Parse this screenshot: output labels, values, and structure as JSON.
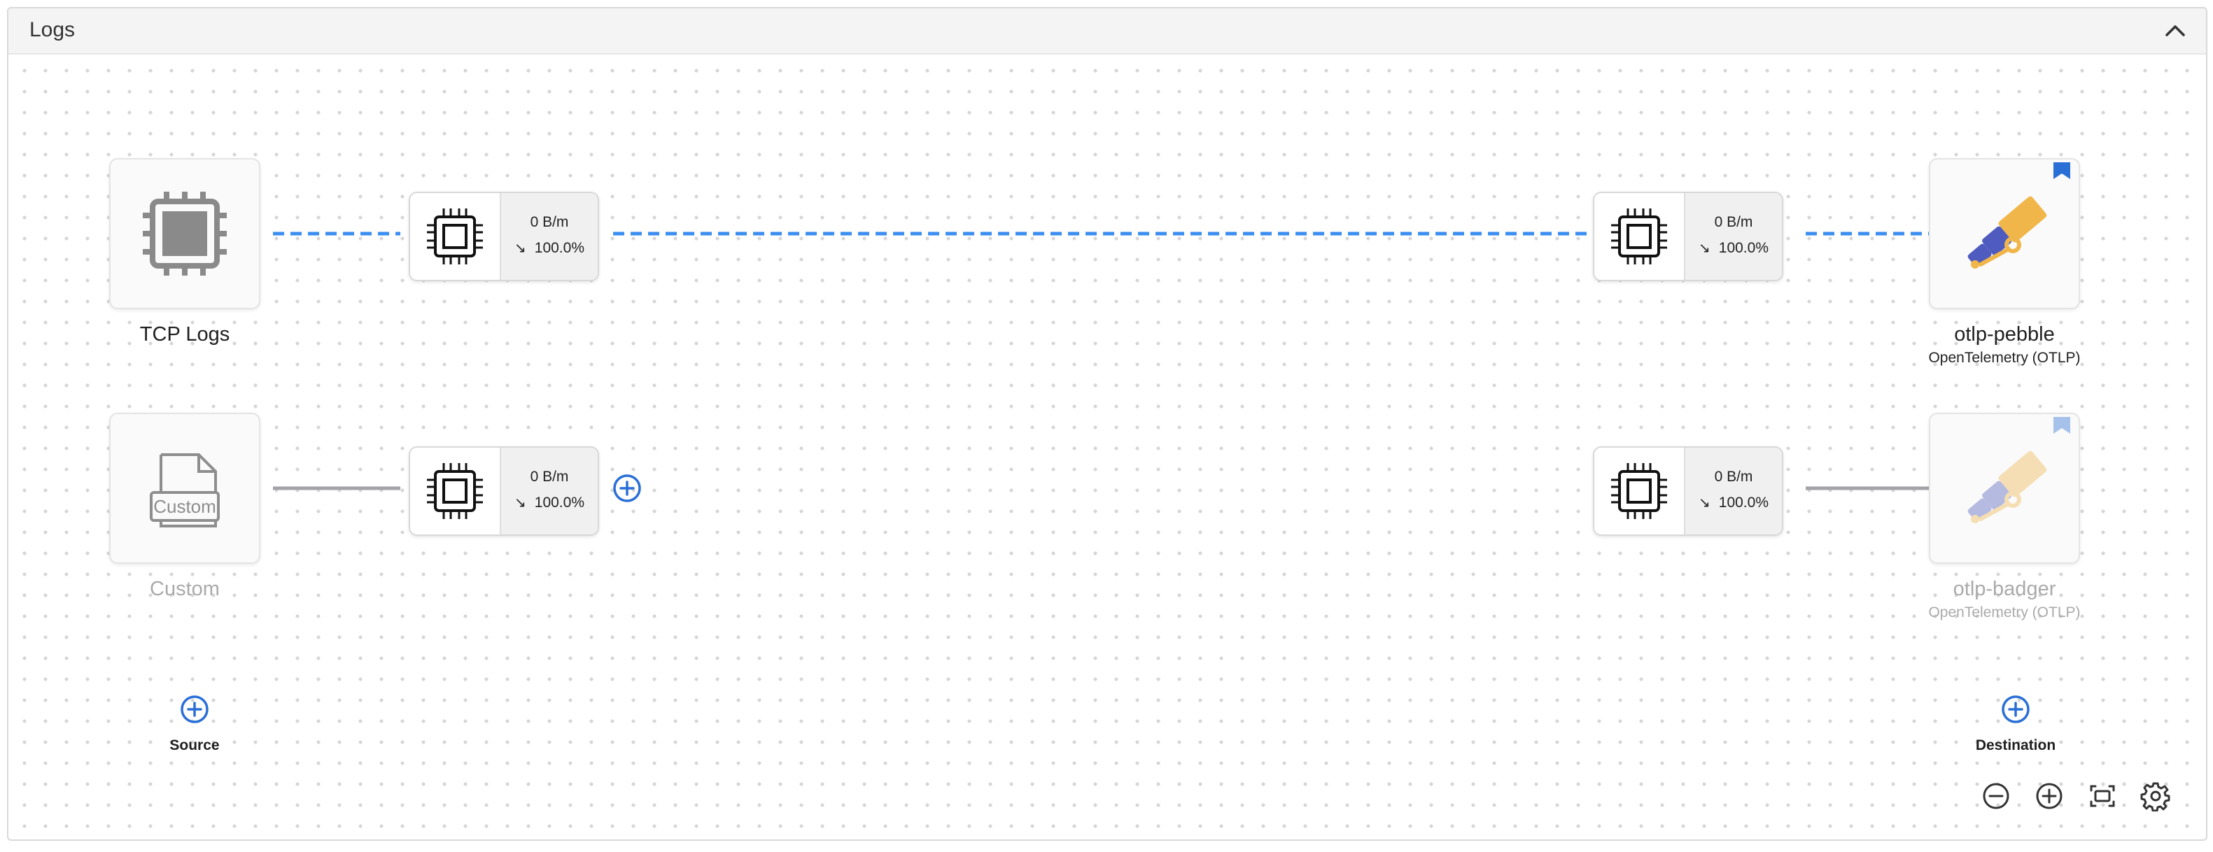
{
  "panel": {
    "title": "Logs"
  },
  "sources": [
    {
      "name": "TCP Logs",
      "icon": "cpu-chip-icon",
      "state": "enabled"
    },
    {
      "name": "Custom",
      "icon": "custom-file-icon",
      "state": "disabled"
    }
  ],
  "processors": [
    {
      "rate": "0 B/m",
      "percent": "100.0%"
    },
    {
      "rate": "0 B/m",
      "percent": "100.0%"
    },
    {
      "rate": "0 B/m",
      "percent": "100.0%"
    },
    {
      "rate": "0 B/m",
      "percent": "100.0%"
    }
  ],
  "destinations": [
    {
      "name": "otlp-pebble",
      "type": "OpenTelemetry (OTLP)",
      "icon": "telescope-icon",
      "state": "enabled"
    },
    {
      "name": "otlp-badger",
      "type": "OpenTelemetry (OTLP)",
      "icon": "telescope-icon",
      "state": "disabled"
    }
  ],
  "add": {
    "source_label": "Source",
    "destination_label": "Destination"
  },
  "colors": {
    "active_edge": "#3b8ef0",
    "inactive_edge": "#a3a3a8",
    "accent": "#2a6fd6"
  },
  "toolbar": [
    "zoom-out-icon",
    "zoom-in-icon",
    "fit-view-icon",
    "settings-icon"
  ]
}
